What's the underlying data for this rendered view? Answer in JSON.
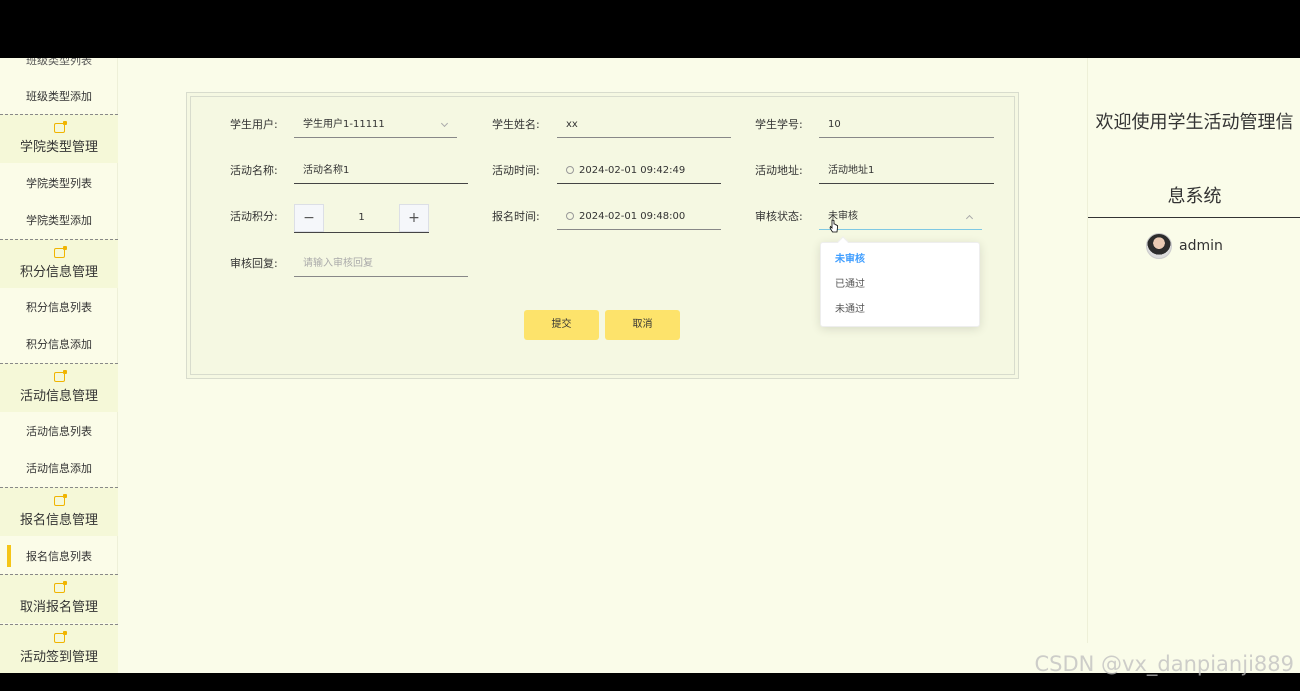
{
  "sidebar": {
    "partial_top": "班级类型列表",
    "class_type_add": "班级类型添加",
    "groups": [
      {
        "label": "学院类型管理",
        "items": [
          "学院类型列表",
          "学院类型添加"
        ]
      },
      {
        "label": "积分信息管理",
        "items": [
          "积分信息列表",
          "积分信息添加"
        ]
      },
      {
        "label": "活动信息管理",
        "items": [
          "活动信息列表",
          "活动信息添加"
        ]
      },
      {
        "label": "报名信息管理",
        "items": [
          "报名信息列表"
        ]
      },
      {
        "label": "取消报名管理",
        "items": []
      },
      {
        "label": "活动签到管理",
        "items": []
      }
    ]
  },
  "header": {
    "welcome": "欢迎使用学生活动管理信息系统",
    "username": "admin"
  },
  "form": {
    "student_user": {
      "label": "学生用户:",
      "value": "学生用户1-11111"
    },
    "student_name": {
      "label": "学生姓名:",
      "value": "xx"
    },
    "student_no": {
      "label": "学生学号:",
      "value": "10"
    },
    "activity_name": {
      "label": "活动名称:",
      "value": "活动名称1"
    },
    "activity_time": {
      "label": "活动时间:",
      "value": "2024-02-01 09:42:49"
    },
    "activity_address": {
      "label": "活动地址:",
      "value": "活动地址1"
    },
    "activity_points": {
      "label": "活动积分:",
      "value": "1",
      "minus": "−",
      "plus": "+"
    },
    "signup_time": {
      "label": "报名时间:",
      "value": "2024-02-01 09:48:00"
    },
    "review_status": {
      "label": "审核状态:",
      "value": "未审核"
    },
    "review_reply": {
      "label": "审核回复:",
      "placeholder": "请输入审核回复"
    },
    "submit_label": "提交",
    "cancel_label": "取消"
  },
  "status_dropdown": {
    "options": [
      "未审核",
      "已通过",
      "未通过"
    ],
    "selected": "未审核"
  },
  "watermark": "CSDN @vx_danpianji889"
}
